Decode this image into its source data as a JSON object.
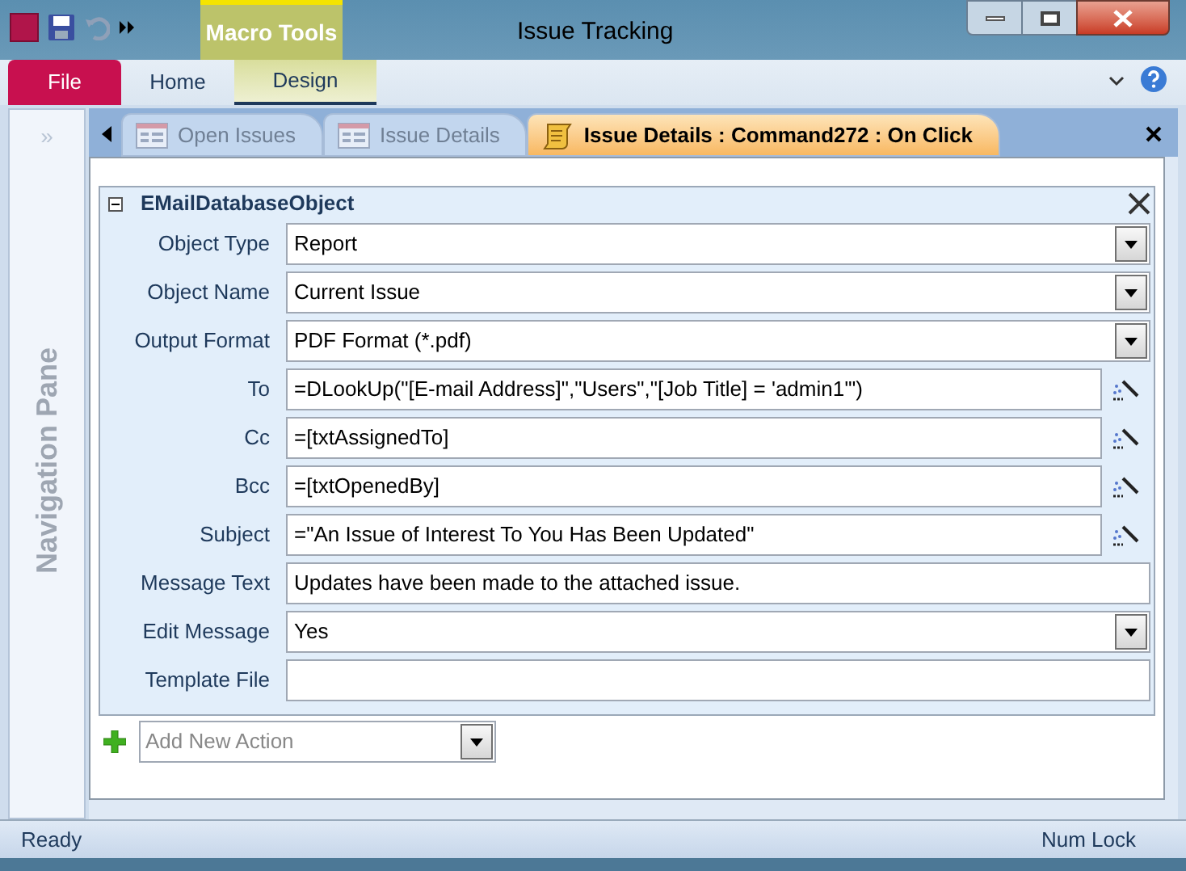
{
  "window": {
    "title": "Issue Tracking"
  },
  "ribbon": {
    "contextual_group": "Macro Tools",
    "tabs": [
      {
        "label": "File",
        "kind": "file",
        "selected": false
      },
      {
        "label": "Home",
        "kind": "tab",
        "selected": false
      },
      {
        "label": "Design",
        "kind": "contextual",
        "selected": true
      }
    ]
  },
  "navigation_pane": {
    "toggle": "»",
    "label": "Navigation Pane"
  },
  "document_tabs": [
    {
      "label": "Open Issues",
      "kind": "form",
      "selected": false
    },
    {
      "label": "Issue Details",
      "kind": "form",
      "selected": false
    },
    {
      "label": "Issue Details : Command272 : On Click",
      "kind": "macro",
      "selected": true
    }
  ],
  "action": {
    "name": "EMailDatabaseObject",
    "expanded": true,
    "arguments": [
      {
        "label": "Object Type",
        "value": "Report",
        "kind": "dropdown"
      },
      {
        "label": "Object Name",
        "value": "Current Issue",
        "kind": "dropdown"
      },
      {
        "label": "Output Format",
        "value": "PDF Format (*.pdf)",
        "kind": "dropdown"
      },
      {
        "label": "To",
        "value": "=DLookUp(\"[E-mail Address]\",\"Users\",\"[Job Title] = 'admin1'\")",
        "kind": "builder"
      },
      {
        "label": "Cc",
        "value": "=[txtAssignedTo]",
        "kind": "builder"
      },
      {
        "label": "Bcc",
        "value": "=[txtOpenedBy]",
        "kind": "builder"
      },
      {
        "label": "Subject",
        "value": "=\"An Issue of Interest To You Has Been Updated\"",
        "kind": "builder"
      },
      {
        "label": "Message Text",
        "value": "Updates have been made to the attached issue.",
        "kind": "text"
      },
      {
        "label": "Edit Message",
        "value": "Yes",
        "kind": "dropdown"
      },
      {
        "label": "Template File",
        "kind": "text"
      }
    ]
  },
  "add_action": {
    "placeholder": "Add New Action"
  },
  "status_bar": {
    "left": "Ready",
    "right": "Num Lock"
  }
}
